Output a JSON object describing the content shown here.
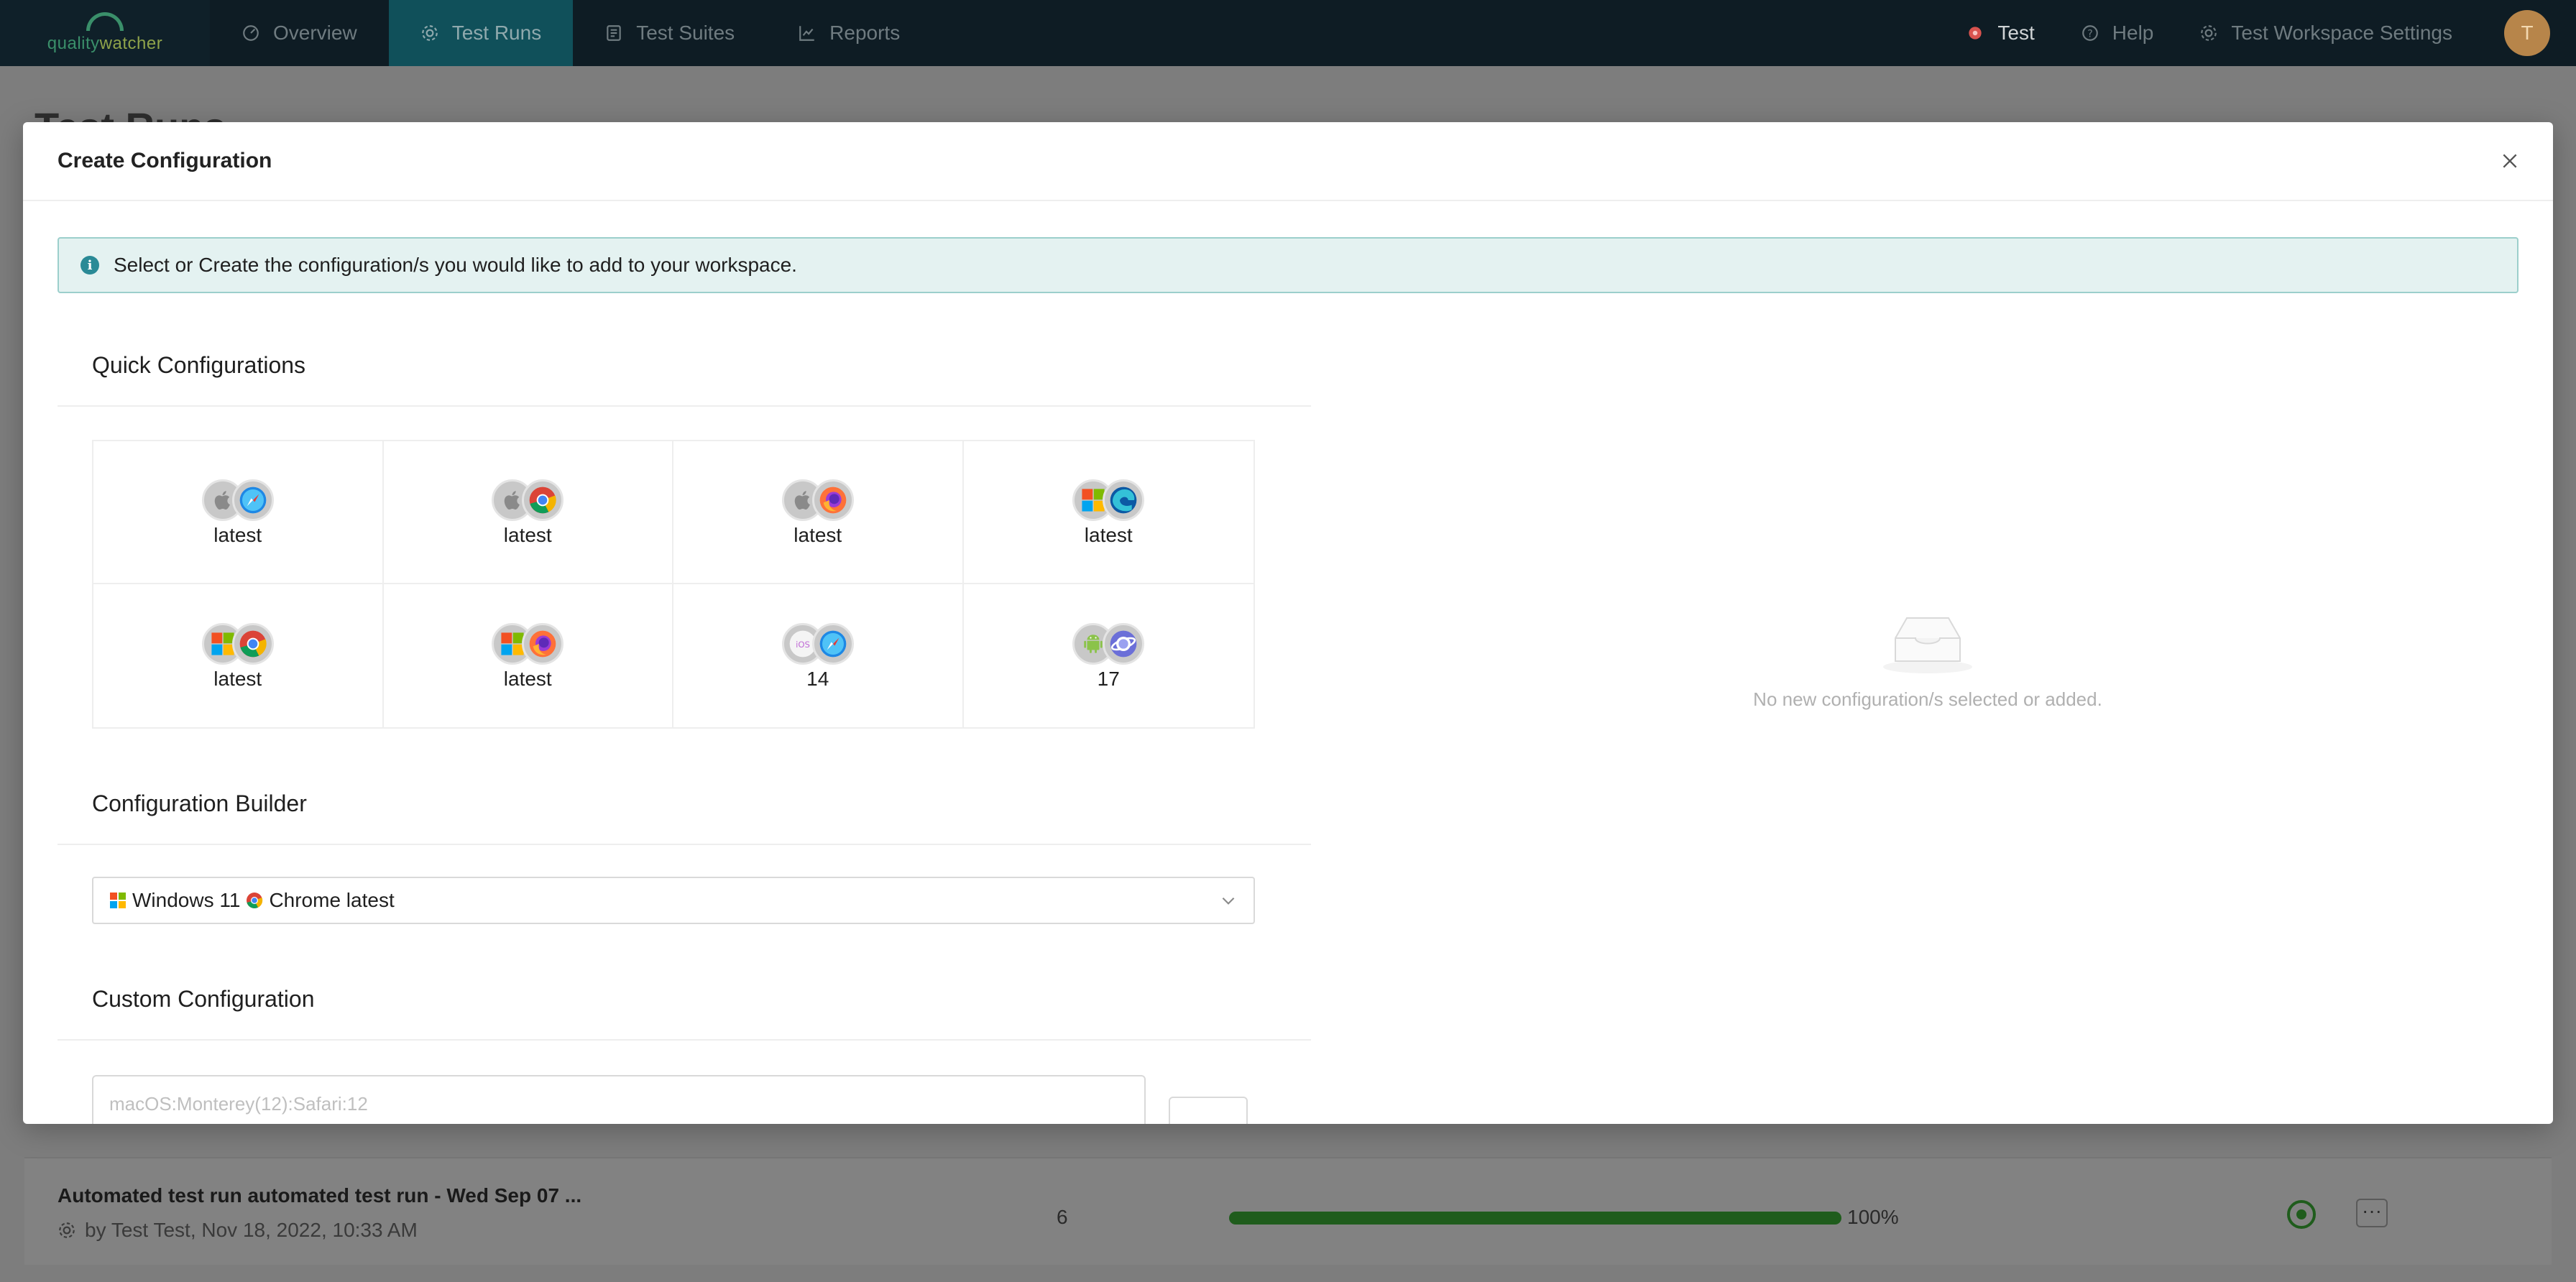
{
  "nav": {
    "logo_text_a": "quality",
    "logo_text_b": "watcher",
    "items": [
      {
        "label": "Overview",
        "icon": "dashboard-icon"
      },
      {
        "label": "Test Runs",
        "icon": "gear-icon",
        "active": true
      },
      {
        "label": "Test Suites",
        "icon": "suite-icon"
      },
      {
        "label": "Reports",
        "icon": "chart-icon"
      }
    ],
    "right": {
      "workspace": "Test",
      "help": "Help",
      "settings": "Test Workspace Settings",
      "avatar_initial": "T"
    }
  },
  "page": {
    "title": "Test Runs",
    "run_row": {
      "title": "Automated test run automated test run - Wed Sep 07 ...",
      "subtitle": "by Test Test, Nov 18, 2022, 10:33 AM",
      "count": "6",
      "progress_label": "100%",
      "progress_fraction": 1.0
    }
  },
  "modal": {
    "title": "Create Configuration",
    "alert": "Select or Create the configuration/s you would like to add to your workspace.",
    "quick_title": "Quick Configurations",
    "quick": [
      {
        "os": "apple-icon",
        "browser": "safari-icon",
        "label": "latest"
      },
      {
        "os": "apple-icon",
        "browser": "chrome-icon",
        "label": "latest"
      },
      {
        "os": "apple-icon",
        "browser": "firefox-icon",
        "label": "latest"
      },
      {
        "os": "windows-icon",
        "browser": "edge-icon",
        "label": "latest"
      },
      {
        "os": "windows-icon",
        "browser": "chrome-icon",
        "label": "latest"
      },
      {
        "os": "windows-icon",
        "browser": "firefox-icon",
        "label": "latest"
      },
      {
        "os": "ios-icon",
        "browser": "safari-icon",
        "label": "14"
      },
      {
        "os": "android-icon",
        "browser": "samsung-internet-icon",
        "label": "17"
      }
    ],
    "builder_title": "Configuration Builder",
    "builder": {
      "os": "Windows 11",
      "browser": "Chrome latest"
    },
    "custom_title": "Custom Configuration",
    "custom_placeholder": "macOS:Monterey(12):Safari:12",
    "empty_text": "No new configuration/s selected or added."
  },
  "colors": {
    "nav_bg": "#0e1c24",
    "nav_active": "#10505a",
    "alert_bg": "#e4f2f1",
    "alert_border": "#9ccfcc",
    "info": "#2a8a96",
    "progress": "#1f5c1c"
  }
}
